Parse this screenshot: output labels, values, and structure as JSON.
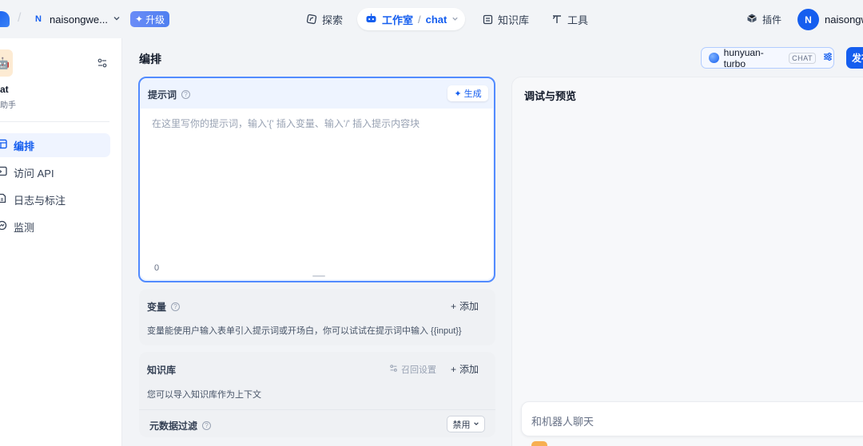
{
  "topbar": {
    "workspace_initial": "N",
    "workspace_name": "naisongwe...",
    "upgrade_label": "升级",
    "nav_explore": "探索",
    "nav_studio": "工作室",
    "nav_studio_app": "chat",
    "nav_knowledge": "知识库",
    "nav_tools": "工具",
    "plugins": "插件",
    "user_initial": "N",
    "user_name": "naisongwe"
  },
  "sidebar": {
    "app_name": "at",
    "app_type": "助手",
    "items": [
      {
        "label": "编排",
        "icon": "layout-icon",
        "active": true
      },
      {
        "label": "访问 API",
        "icon": "terminal-icon",
        "active": false
      },
      {
        "label": "日志与标注",
        "icon": "file-edit-icon",
        "active": false
      },
      {
        "label": "监测",
        "icon": "monitor-icon",
        "active": false
      }
    ]
  },
  "main": {
    "title": "编排",
    "model_name": "hunyuan-turbo",
    "model_mode": "CHAT",
    "publish_label": "发布"
  },
  "prompt": {
    "title": "提示词",
    "generate_label": "生成",
    "placeholder": "在这里写你的提示词，输入'{' 插入变量、输入'/' 插入提示内容块",
    "counter": "0"
  },
  "variables": {
    "title": "变量",
    "add_label": "添加",
    "description": "变量能使用户输入表单引入提示词或开场白，你可以试试在提示词中输入 {{input}}"
  },
  "knowledge": {
    "title": "知识库",
    "recall_label": "召回设置",
    "add_label": "添加",
    "description": "您可以导入知识库作为上下文",
    "meta_filter_title": "元数据过滤",
    "meta_filter_value": "禁用"
  },
  "debug": {
    "title": "调试与预览",
    "input_placeholder": "和机器人聊天"
  },
  "colors": {
    "accent": "#155eef",
    "focus_border": "#528bff",
    "active_bg": "#eff4ff"
  }
}
